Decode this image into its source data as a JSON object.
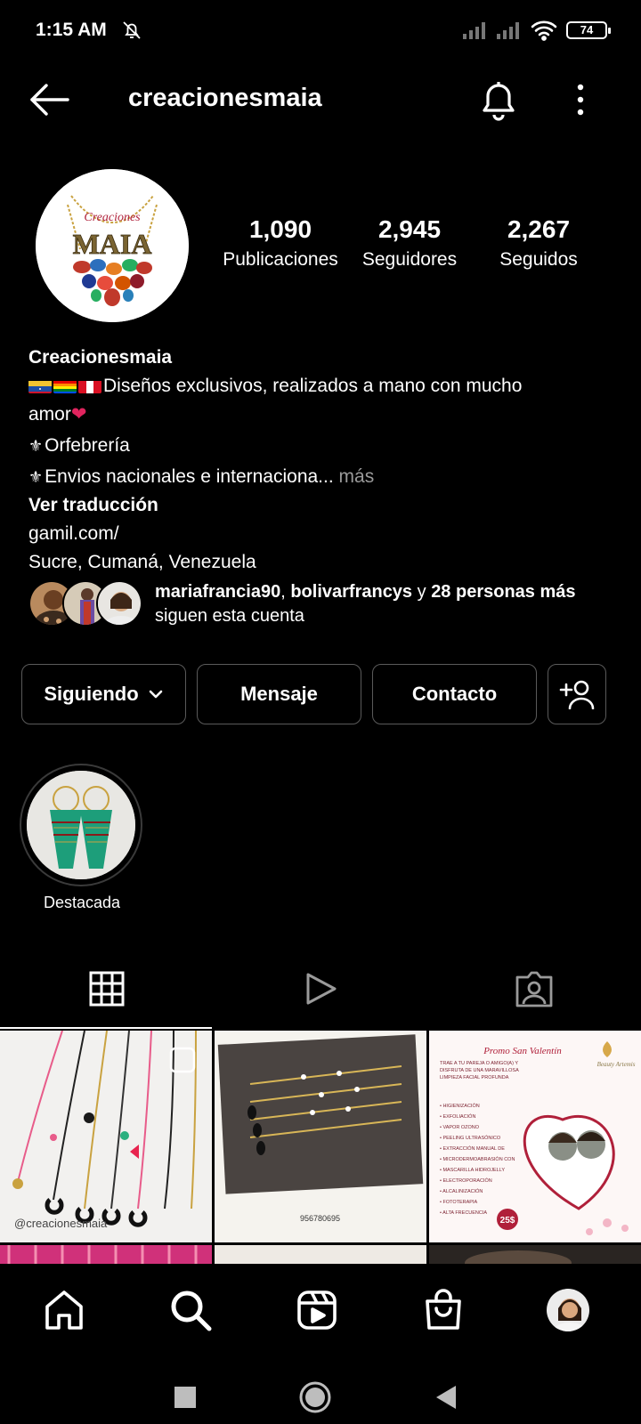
{
  "status_bar": {
    "time": "1:15 AM",
    "battery": "74"
  },
  "header": {
    "username": "creacionesmaia"
  },
  "profile": {
    "avatar_text_top": "Creaciones",
    "avatar_text_main": "MAIA",
    "stats": [
      {
        "value": "1,090",
        "label": "Publicaciones"
      },
      {
        "value": "2,945",
        "label": "Seguidores"
      },
      {
        "value": "2,267",
        "label": "Seguidos"
      }
    ]
  },
  "bio": {
    "name": "Creacionesmaia",
    "line1": "Diseños exclusivos, realizados a mano con mucho",
    "line2": "amor",
    "line3": "Orfebrería",
    "line4": "Envios nacionales e internaciona...",
    "more": "más",
    "translate": "Ver traducción",
    "link": "gamil.com/",
    "location": "Sucre, Cumaná, Venezuela"
  },
  "followed_by": {
    "user1": "mariafrancia90",
    "user2": "bolivarfrancys",
    "connector": "y",
    "others": "28 personas más",
    "suffix": "siguen esta cuenta"
  },
  "actions": {
    "following": "Siguiendo",
    "message": "Mensaje",
    "contact": "Contacto"
  },
  "highlight": {
    "label": "Destacada"
  },
  "posts": [
    {
      "caption": "@creacionesmaia"
    },
    {
      "caption": "956780695"
    },
    {
      "title": "Promo San Valentín",
      "subtitle": "TRAE A TU PAREJA O AMIGO(A) Y DISFRUTA DE UNA MARAVILLOSA LIMPIEZA FACIAL PROFUNDA",
      "brand": "Beauty Artemis",
      "items": [
        "HIGIENIZACIÓN",
        "EXFOLIACIÓN",
        "VAPOR OZONO",
        "PEELING ULTRASÓNICO",
        "EXTRACCIÓN MANUAL DE IMPUREZAS",
        "MICRODERMOABRASIÓN CON PUNTAS DE DIAMANTES",
        "MASCARILLA HIDROJELLY",
        "ELECTROPORACIÓN",
        "ALCALINIZACIÓN",
        "FOTOTERAPIA",
        "ALTA FRECUENCIA"
      ],
      "price": "25$"
    }
  ],
  "colors": {
    "background": "#000000",
    "border": "#5a5a5a",
    "muted": "#9a9a9a"
  }
}
